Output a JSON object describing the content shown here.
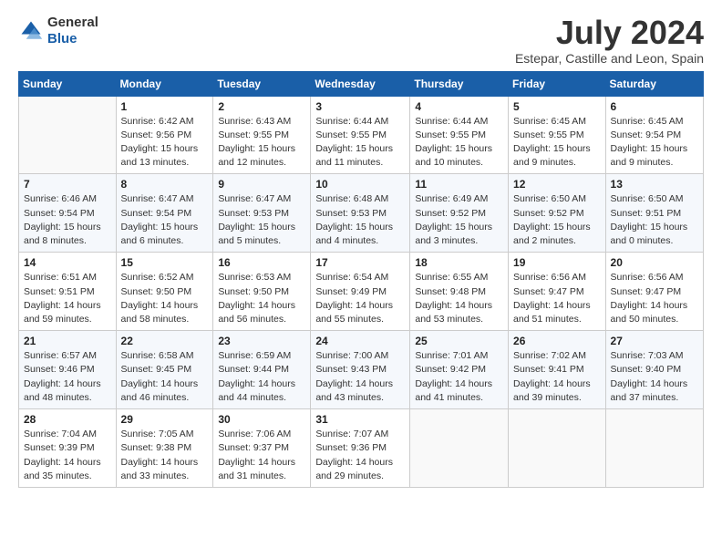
{
  "header": {
    "logo_line1": "General",
    "logo_line2": "Blue",
    "month_title": "July 2024",
    "location": "Estepar, Castille and Leon, Spain"
  },
  "days_of_week": [
    "Sunday",
    "Monday",
    "Tuesday",
    "Wednesday",
    "Thursday",
    "Friday",
    "Saturday"
  ],
  "weeks": [
    [
      {
        "num": "",
        "info": ""
      },
      {
        "num": "1",
        "info": "Sunrise: 6:42 AM\nSunset: 9:56 PM\nDaylight: 15 hours\nand 13 minutes."
      },
      {
        "num": "2",
        "info": "Sunrise: 6:43 AM\nSunset: 9:55 PM\nDaylight: 15 hours\nand 12 minutes."
      },
      {
        "num": "3",
        "info": "Sunrise: 6:44 AM\nSunset: 9:55 PM\nDaylight: 15 hours\nand 11 minutes."
      },
      {
        "num": "4",
        "info": "Sunrise: 6:44 AM\nSunset: 9:55 PM\nDaylight: 15 hours\nand 10 minutes."
      },
      {
        "num": "5",
        "info": "Sunrise: 6:45 AM\nSunset: 9:55 PM\nDaylight: 15 hours\nand 9 minutes."
      },
      {
        "num": "6",
        "info": "Sunrise: 6:45 AM\nSunset: 9:54 PM\nDaylight: 15 hours\nand 9 minutes."
      }
    ],
    [
      {
        "num": "7",
        "info": "Sunrise: 6:46 AM\nSunset: 9:54 PM\nDaylight: 15 hours\nand 8 minutes."
      },
      {
        "num": "8",
        "info": "Sunrise: 6:47 AM\nSunset: 9:54 PM\nDaylight: 15 hours\nand 6 minutes."
      },
      {
        "num": "9",
        "info": "Sunrise: 6:47 AM\nSunset: 9:53 PM\nDaylight: 15 hours\nand 5 minutes."
      },
      {
        "num": "10",
        "info": "Sunrise: 6:48 AM\nSunset: 9:53 PM\nDaylight: 15 hours\nand 4 minutes."
      },
      {
        "num": "11",
        "info": "Sunrise: 6:49 AM\nSunset: 9:52 PM\nDaylight: 15 hours\nand 3 minutes."
      },
      {
        "num": "12",
        "info": "Sunrise: 6:50 AM\nSunset: 9:52 PM\nDaylight: 15 hours\nand 2 minutes."
      },
      {
        "num": "13",
        "info": "Sunrise: 6:50 AM\nSunset: 9:51 PM\nDaylight: 15 hours\nand 0 minutes."
      }
    ],
    [
      {
        "num": "14",
        "info": "Sunrise: 6:51 AM\nSunset: 9:51 PM\nDaylight: 14 hours\nand 59 minutes."
      },
      {
        "num": "15",
        "info": "Sunrise: 6:52 AM\nSunset: 9:50 PM\nDaylight: 14 hours\nand 58 minutes."
      },
      {
        "num": "16",
        "info": "Sunrise: 6:53 AM\nSunset: 9:50 PM\nDaylight: 14 hours\nand 56 minutes."
      },
      {
        "num": "17",
        "info": "Sunrise: 6:54 AM\nSunset: 9:49 PM\nDaylight: 14 hours\nand 55 minutes."
      },
      {
        "num": "18",
        "info": "Sunrise: 6:55 AM\nSunset: 9:48 PM\nDaylight: 14 hours\nand 53 minutes."
      },
      {
        "num": "19",
        "info": "Sunrise: 6:56 AM\nSunset: 9:47 PM\nDaylight: 14 hours\nand 51 minutes."
      },
      {
        "num": "20",
        "info": "Sunrise: 6:56 AM\nSunset: 9:47 PM\nDaylight: 14 hours\nand 50 minutes."
      }
    ],
    [
      {
        "num": "21",
        "info": "Sunrise: 6:57 AM\nSunset: 9:46 PM\nDaylight: 14 hours\nand 48 minutes."
      },
      {
        "num": "22",
        "info": "Sunrise: 6:58 AM\nSunset: 9:45 PM\nDaylight: 14 hours\nand 46 minutes."
      },
      {
        "num": "23",
        "info": "Sunrise: 6:59 AM\nSunset: 9:44 PM\nDaylight: 14 hours\nand 44 minutes."
      },
      {
        "num": "24",
        "info": "Sunrise: 7:00 AM\nSunset: 9:43 PM\nDaylight: 14 hours\nand 43 minutes."
      },
      {
        "num": "25",
        "info": "Sunrise: 7:01 AM\nSunset: 9:42 PM\nDaylight: 14 hours\nand 41 minutes."
      },
      {
        "num": "26",
        "info": "Sunrise: 7:02 AM\nSunset: 9:41 PM\nDaylight: 14 hours\nand 39 minutes."
      },
      {
        "num": "27",
        "info": "Sunrise: 7:03 AM\nSunset: 9:40 PM\nDaylight: 14 hours\nand 37 minutes."
      }
    ],
    [
      {
        "num": "28",
        "info": "Sunrise: 7:04 AM\nSunset: 9:39 PM\nDaylight: 14 hours\nand 35 minutes."
      },
      {
        "num": "29",
        "info": "Sunrise: 7:05 AM\nSunset: 9:38 PM\nDaylight: 14 hours\nand 33 minutes."
      },
      {
        "num": "30",
        "info": "Sunrise: 7:06 AM\nSunset: 9:37 PM\nDaylight: 14 hours\nand 31 minutes."
      },
      {
        "num": "31",
        "info": "Sunrise: 7:07 AM\nSunset: 9:36 PM\nDaylight: 14 hours\nand 29 minutes."
      },
      {
        "num": "",
        "info": ""
      },
      {
        "num": "",
        "info": ""
      },
      {
        "num": "",
        "info": ""
      }
    ]
  ]
}
